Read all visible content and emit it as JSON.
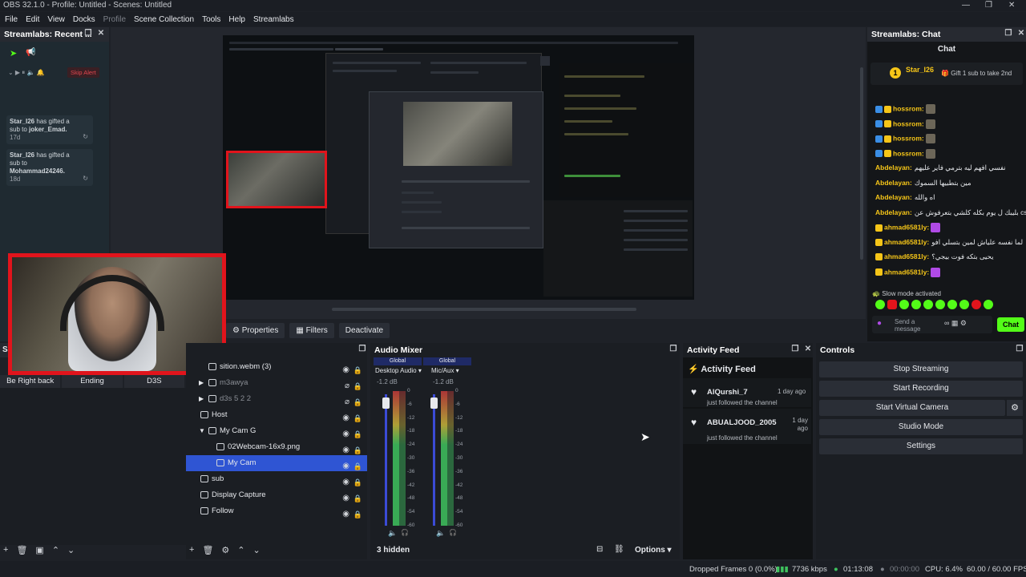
{
  "window": {
    "title": "OBS 32.1.0 - Profile: Untitled - Scenes: Untitled",
    "controls": [
      "—",
      "❐",
      "✕"
    ]
  },
  "menu": [
    "File",
    "Edit",
    "View",
    "Docks",
    "Profile",
    "Scene Collection",
    "Tools",
    "Help",
    "Streamlabs"
  ],
  "recent_events": {
    "title": "Streamlabs: Recent ...",
    "skip_alert": "Skip Alert",
    "items": [
      {
        "user": "Star_I26",
        "line1": "has gifted a",
        "line2": "sub to",
        "target": "joker_Emad.",
        "time": "17d"
      },
      {
        "user": "Star_I26",
        "line1": "has gifted a",
        "line2": "sub to",
        "target": "Mohammad24246.",
        "time": "18d"
      }
    ]
  },
  "preview_toolbar": {
    "properties": "Properties",
    "filters": "Filters",
    "deactivate": "Deactivate"
  },
  "scenes": {
    "title": "S",
    "buttons": [
      "Be Right back",
      "Ending",
      "D3S"
    ]
  },
  "sources": {
    "items": [
      {
        "label": "sition.webm (3)",
        "icon": "video-icon",
        "indent": 1,
        "expand": ""
      },
      {
        "label": "m3awya",
        "icon": "folder-icon",
        "indent": 1,
        "expand": "▶",
        "dim": true
      },
      {
        "label": "d3s 5 2 2",
        "icon": "folder-icon",
        "indent": 1,
        "expand": "▶",
        "dim": true
      },
      {
        "label": "Host",
        "icon": "scene-icon",
        "indent": 0,
        "expand": ""
      },
      {
        "label": "My Cam G",
        "icon": "folder-icon",
        "indent": 1,
        "expand": "▼"
      },
      {
        "label": "02Webcam-16x9.png",
        "icon": "image-icon",
        "indent": 2,
        "expand": ""
      },
      {
        "label": "My Cam",
        "icon": "camera-icon",
        "indent": 2,
        "expand": "",
        "selected": true
      },
      {
        "label": "sub",
        "icon": "scene-icon",
        "indent": 0,
        "expand": ""
      },
      {
        "label": "Display Capture",
        "icon": "monitor-icon",
        "indent": 0,
        "expand": ""
      },
      {
        "label": "Follow",
        "icon": "scene-icon",
        "indent": 0,
        "expand": ""
      }
    ]
  },
  "audio_mixer": {
    "title": "Audio Mixer",
    "channels": [
      {
        "global": "Global",
        "name": "Desktop Audio",
        "db": "-1.2 dB"
      },
      {
        "global": "Global",
        "name": "Mic/Aux",
        "db": "-1.2 dB"
      }
    ],
    "ticks": [
      "0",
      "-6",
      "-12",
      "-18",
      "-24",
      "-30",
      "-36",
      "-42",
      "-48",
      "-54",
      "-60"
    ],
    "hidden": "3 hidden",
    "options": "Options"
  },
  "activity_feed": {
    "title": "Activity Feed",
    "heading": "Activity Feed",
    "items": [
      {
        "user": "AlQurshi_7",
        "action": "just followed the channel",
        "time": "1 day ago"
      },
      {
        "user": "ABUALJOOD_2005",
        "action": "just followed the channel",
        "time": "1 day ago"
      }
    ]
  },
  "controls": {
    "title": "Controls",
    "buttons": [
      "Stop Streaming",
      "Start Recording",
      "Start Virtual Camera",
      "Studio Mode",
      "Settings"
    ]
  },
  "chat": {
    "title": "Streamlabs: Chat",
    "heading": "Chat",
    "top_user": "Star_I26",
    "rank": "1",
    "gift_prompt": "Gift 1 sub to take 2nd",
    "messages": [
      {
        "user": "hossrom:",
        "text": "",
        "color": "#f5c518"
      },
      {
        "user": "hossrom:",
        "text": "",
        "color": "#f5c518"
      },
      {
        "user": "hossrom:",
        "text": "",
        "color": "#f5c518"
      },
      {
        "user": "hossrom:",
        "text": "",
        "color": "#f5c518"
      },
      {
        "user": "Abdelayan:",
        "text": "نفسي افهم ليه بترمي فاير عليهم",
        "color": "#f5c518"
      },
      {
        "user": "Abdelayan:",
        "text": "مين بتطبيها السموك",
        "color": "#f5c518"
      },
      {
        "user": "Abdelayan:",
        "text": "اه والله",
        "color": "#f5c518"
      },
      {
        "user": "Abdelayan:",
        "text": "بليبك ل يوم بكله كلشي بتعرفوش عن cs",
        "color": "#f5c518"
      },
      {
        "user": "ahmad6581ly:",
        "text": "",
        "color": "#f5c518"
      },
      {
        "user": "ahmad6581ly:",
        "text": "لما نفسه علياش لمين بتسلي افو",
        "color": "#f5c518"
      },
      {
        "user": "ahmad6581ly:",
        "text": "يحيى بتكه فوت بيجي؟",
        "color": "#f5c518"
      },
      {
        "user": "ahmad6581ly:",
        "text": "",
        "color": "#f5c518"
      }
    ],
    "slow_mode": "Slow mode activated",
    "send_placeholder": "Send a message",
    "chat_button": "Chat"
  },
  "status": {
    "dropped": "Dropped Frames 0 (0.0%)",
    "kbps": "7736 kbps",
    "live_time": "01:13:08",
    "rec_time": "00:00:00",
    "cpu": "CPU: 6.4%",
    "fps": "60.00 / 60.00 FPS"
  },
  "colors": {
    "accent": "#2f55d3",
    "streamlabs_green": "#53fc18",
    "alert_red": "#e1141c"
  }
}
